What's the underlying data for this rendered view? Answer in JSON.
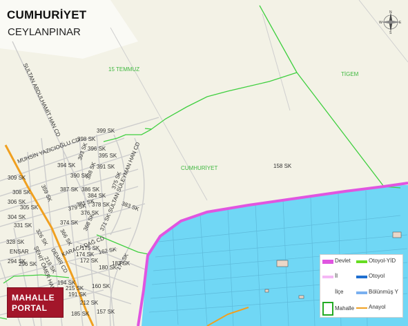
{
  "map": {
    "title": "CUMHURİYET",
    "subtitle": "CEYLANPINAR",
    "areas": [
      {
        "key": "a1",
        "name": "15 TEMMUZ"
      },
      {
        "key": "a2",
        "name": "TİGEM"
      },
      {
        "key": "a3",
        "name": "CUMHURİYET"
      }
    ],
    "streets": [
      {
        "key": "s1",
        "name": "SULTAN ABDULHAMİT HAN CD"
      },
      {
        "key": "s2",
        "name": "MUHSİN YAZICIOĞLU CD"
      },
      {
        "key": "s3",
        "name": "SULTAN SÜLEYMAN HAN CD"
      },
      {
        "key": "s4",
        "name": "KARACA DAĞ CD"
      },
      {
        "key": "s5",
        "name": "ŞEHİT ÖMER HALİS"
      },
      {
        "key": "s6",
        "name": "DEMİR CD"
      },
      {
        "key": "s7",
        "name": "399 SK"
      },
      {
        "key": "s8",
        "name": "398 SK"
      },
      {
        "key": "s9",
        "name": "396 SK"
      },
      {
        "key": "s10",
        "name": "395 SK"
      },
      {
        "key": "s11",
        "name": "393 SK"
      },
      {
        "key": "s12",
        "name": "394 SK"
      },
      {
        "key": "s13",
        "name": "391 SK"
      },
      {
        "key": "s14",
        "name": "390 SK"
      },
      {
        "key": "s15",
        "name": "388 SK"
      },
      {
        "key": "s16",
        "name": "387 SK"
      },
      {
        "key": "s17",
        "name": "386 SK"
      },
      {
        "key": "s18",
        "name": "384 SK"
      },
      {
        "key": "s19",
        "name": "383 SK"
      },
      {
        "key": "s20",
        "name": "381 SK"
      },
      {
        "key": "s21",
        "name": "379 SK"
      },
      {
        "key": "s22",
        "name": "378 SK"
      },
      {
        "key": "s23",
        "name": "376 SK"
      },
      {
        "key": "s24",
        "name": "375 SK"
      },
      {
        "key": "s25",
        "name": "374 SK"
      },
      {
        "key": "s26",
        "name": "371 SK"
      },
      {
        "key": "s27",
        "name": "368 SK"
      },
      {
        "key": "s28",
        "name": "366 SK"
      },
      {
        "key": "s29",
        "name": "309 SK"
      },
      {
        "key": "s30",
        "name": "308 SK"
      },
      {
        "key": "s31",
        "name": "306 SK"
      },
      {
        "key": "s32",
        "name": "305 SK"
      },
      {
        "key": "s33",
        "name": "304 SK"
      },
      {
        "key": "s34",
        "name": "331 SK"
      },
      {
        "key": "s35",
        "name": "326 SK"
      },
      {
        "key": "s36",
        "name": "328 SK"
      },
      {
        "key": "s37",
        "name": "294 SK"
      },
      {
        "key": "s38",
        "name": "296 SK"
      },
      {
        "key": "s39",
        "name": "218 SK"
      },
      {
        "key": "s40",
        "name": "158 SK"
      },
      {
        "key": "s41",
        "name": "175 SK"
      },
      {
        "key": "s42",
        "name": "174 SK"
      },
      {
        "key": "s43",
        "name": "172 SK"
      },
      {
        "key": "s44",
        "name": "162 SK"
      },
      {
        "key": "s45",
        "name": "183 SK"
      },
      {
        "key": "s46",
        "name": "180 SK"
      },
      {
        "key": "s47",
        "name": "179 SK"
      },
      {
        "key": "s48",
        "name": "194 SK"
      },
      {
        "key": "s49",
        "name": "215 SK"
      },
      {
        "key": "s50",
        "name": "191 SK"
      },
      {
        "key": "s51",
        "name": "160 SK"
      },
      {
        "key": "s52",
        "name": "212 SK"
      },
      {
        "key": "s53",
        "name": "185 SK"
      },
      {
        "key": "s54",
        "name": "157 SK"
      },
      {
        "key": "s55",
        "name": "ENSAR"
      },
      {
        "key": "s56",
        "name": "359 SK"
      }
    ],
    "compass": {
      "n": "N",
      "s": "S",
      "e": "E",
      "w": "W"
    }
  },
  "logo": {
    "line1": "MAHALLE",
    "line2": "PORTAL"
  },
  "legend": [
    {
      "label": "Devlet",
      "color": "#e055e0",
      "kind": "line"
    },
    {
      "label": "Otoyol-YİD",
      "color": "#66dd22",
      "kind": "line"
    },
    {
      "label": "İl",
      "color": "#f5b8f5",
      "kind": "line"
    },
    {
      "label": "Otoyol",
      "color": "#1f6fd0",
      "kind": "line"
    },
    {
      "label": "İlçe",
      "color": "#ffffff",
      "kind": "line"
    },
    {
      "label": "Bölünmüş Y",
      "color": "#7ab0f0",
      "kind": "line"
    },
    {
      "label": "Mahalle",
      "color": "#22aa22",
      "kind": "box"
    },
    {
      "label": "Anayol",
      "color": "#f0a020",
      "kind": "line"
    }
  ],
  "colors": {
    "land": "#f3f2e6",
    "water": "#70d7f5",
    "state_road": "#e055e0",
    "boundary": "#3fcf3f",
    "street": "#cfcfcf",
    "arterial": "#f0a020",
    "building": "#ead7c8"
  }
}
